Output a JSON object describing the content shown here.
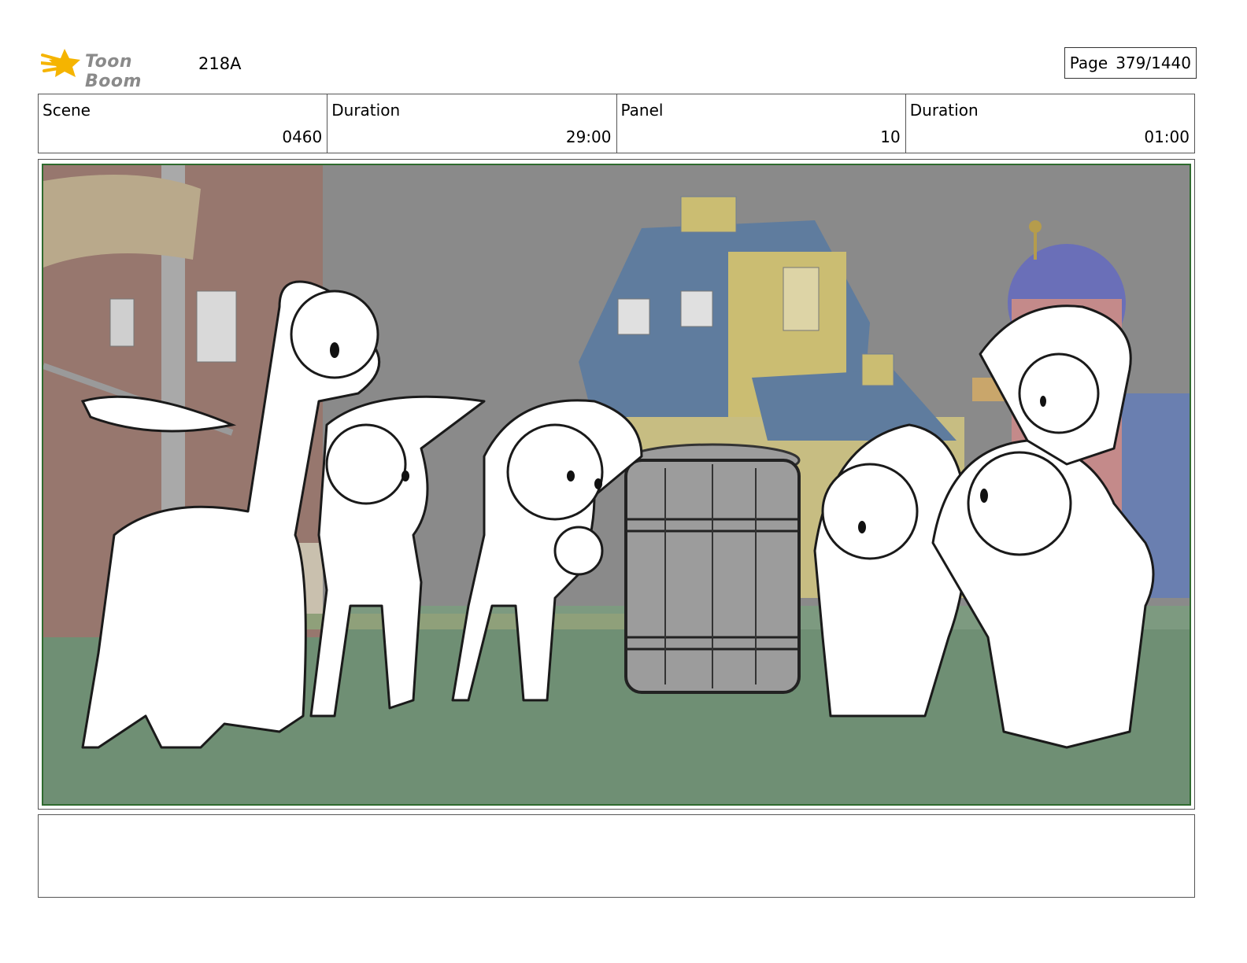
{
  "header": {
    "logo_text": "Toon Boom",
    "project_code": "218A",
    "page_label": "Page",
    "page_number": "379/1440"
  },
  "info": {
    "scene_label": "Scene",
    "scene_value": "0460",
    "scene_duration_label": "Duration",
    "scene_duration_value": "29:00",
    "panel_label": "Panel",
    "panel_value": "10",
    "panel_duration_label": "Duration",
    "panel_duration_value": "01:00"
  },
  "panel": {
    "icon": "storyboard-sketch",
    "border_color": "#2f6b2f"
  },
  "notes": {
    "text": ""
  },
  "colors": {
    "logo_star": "#f5b400",
    "logo_text": "#8a8a8a"
  }
}
